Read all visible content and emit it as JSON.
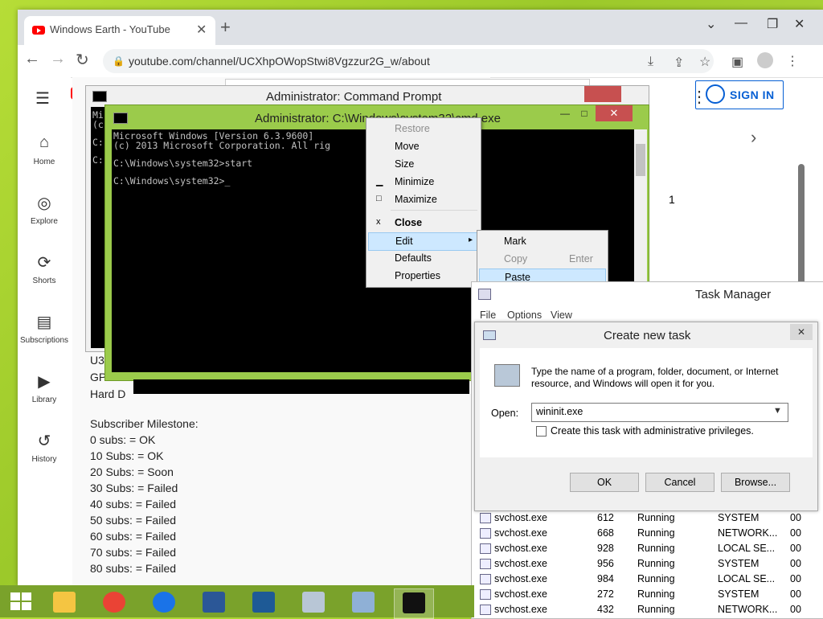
{
  "browser": {
    "tab_title": "Windows Earth - YouTube",
    "url": "youtube.com/channel/UCXhpOWopStwi8Vgzzur2G_w/about"
  },
  "youtube": {
    "nav": [
      {
        "label": "Home",
        "icon": "home-icon"
      },
      {
        "label": "Explore",
        "icon": "compass-icon"
      },
      {
        "label": "Shorts",
        "icon": "shorts-icon"
      },
      {
        "label": "Subscriptions",
        "icon": "subscriptions-icon"
      },
      {
        "label": "Library",
        "icon": "library-icon"
      },
      {
        "label": "History",
        "icon": "history-icon"
      }
    ],
    "sign_in": "SIGN IN",
    "partial_lines": [
      "U3",
      "GP",
      "Hard D"
    ],
    "milestone_title": "Subscriber Milestone:",
    "milestones": [
      "0 subs: = OK",
      "10 Subs: = OK",
      "20 Subs: = Soon",
      "30 Subs: = Failed",
      "40 subs: = Failed",
      "50 subs: = Failed",
      "60 subs: = Failed",
      "70 subs: = Failed",
      "80 subs: = Failed"
    ],
    "side_number": "1",
    "chevron": "›"
  },
  "cmd_back": {
    "title": "Administrator: Command Prompt",
    "lines": [
      "Mi",
      "(c",
      "",
      "C:",
      "",
      "C:"
    ]
  },
  "cmd_front": {
    "title": "Administrator: C:\\Windows\\system32\\cmd.exe",
    "lines": [
      "Microsoft Windows [Version 6.3.9600]",
      "(c) 2013 Microsoft Corporation. All rig",
      "",
      "C:\\Windows\\system32>start",
      "",
      "C:\\Windows\\system32>_"
    ]
  },
  "context_menu": {
    "items": [
      {
        "label": "Restore",
        "glyph": "",
        "disabled": true
      },
      {
        "label": "Move",
        "glyph": ""
      },
      {
        "label": "Size",
        "glyph": ""
      },
      {
        "label": "Minimize",
        "glyph": "▁"
      },
      {
        "label": "Maximize",
        "glyph": "□"
      },
      {
        "label": "Close",
        "glyph": "x",
        "bold": true
      },
      {
        "label": "Edit",
        "glyph": "",
        "selected": true,
        "arrow": "▸"
      },
      {
        "label": "Defaults",
        "glyph": ""
      },
      {
        "label": "Properties",
        "glyph": ""
      }
    ],
    "submenu": [
      {
        "label": "Mark",
        "accel": ""
      },
      {
        "label": "Copy",
        "accel": "Enter",
        "disabled": true
      },
      {
        "label": "Paste",
        "accel": "",
        "selected": true
      }
    ]
  },
  "task_manager": {
    "title": "Task Manager",
    "menu": [
      "File",
      "Options",
      "View"
    ],
    "rows": [
      {
        "name": "svchost.exe",
        "pid": "612",
        "status": "Running",
        "user": "SYSTEM",
        "cpu": "00"
      },
      {
        "name": "svchost.exe",
        "pid": "668",
        "status": "Running",
        "user": "NETWORK...",
        "cpu": "00"
      },
      {
        "name": "svchost.exe",
        "pid": "928",
        "status": "Running",
        "user": "LOCAL SE...",
        "cpu": "00"
      },
      {
        "name": "svchost.exe",
        "pid": "956",
        "status": "Running",
        "user": "SYSTEM",
        "cpu": "00"
      },
      {
        "name": "svchost.exe",
        "pid": "984",
        "status": "Running",
        "user": "LOCAL SE...",
        "cpu": "00"
      },
      {
        "name": "svchost.exe",
        "pid": "272",
        "status": "Running",
        "user": "SYSTEM",
        "cpu": "00"
      },
      {
        "name": "svchost.exe",
        "pid": "432",
        "status": "Running",
        "user": "NETWORK...",
        "cpu": "00"
      }
    ]
  },
  "run_dialog": {
    "title": "Create new task",
    "description": "Type the name of a program, folder, document, or Internet resource, and Windows will open it for you.",
    "open_label": "Open:",
    "open_value": "wininit.exe",
    "admin_checkbox": "Create this task with administrative privileges.",
    "ok": "OK",
    "cancel": "Cancel",
    "browse": "Browse..."
  },
  "taskbar": {
    "apps": [
      "file-explorer-icon",
      "chrome-icon",
      "ccleaner-icon",
      "settings-app-icon",
      "defender-icon",
      "task-manager-icon",
      "run-dialog-icon",
      "command-prompt-icon"
    ]
  },
  "colors": {
    "desktop": "#b6dd37",
    "cmd_frame": "#9bcb4b",
    "youtube_red": "#ff0000",
    "link_blue": "#065fd4"
  }
}
